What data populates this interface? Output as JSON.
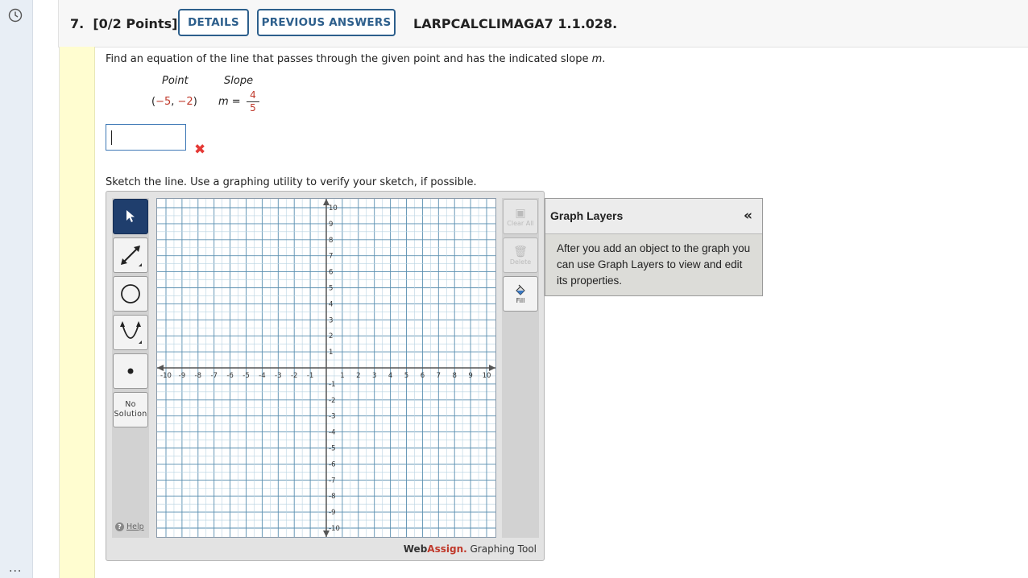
{
  "rail": {
    "clock_icon": "clock-icon",
    "more_label": "..."
  },
  "question": {
    "number": "7.",
    "points": "[0/2 Points]",
    "details_label": "DETAILS",
    "previous_label": "PREVIOUS ANSWERS",
    "code": "LARPCALCLIMAGA7 1.1.028."
  },
  "problem": {
    "prompt_before": "Find an equation of the line that passes through the given point and has the indicated slope ",
    "prompt_var": "m",
    "prompt_after": ".",
    "point_header": "Point",
    "slope_header": "Slope",
    "point_open": "(",
    "point_x": "−5",
    "point_sep": ", ",
    "point_y": "−2",
    "point_close": ")",
    "slope_var": "m",
    "slope_eq": " =",
    "slope_num": "4",
    "slope_den": "5",
    "answer_value": "",
    "answer_status": "incorrect",
    "sketch_prompt": "Sketch the line. Use a graphing utility to verify your sketch, if possible."
  },
  "graph_tool": {
    "tools": [
      "pointer-tool",
      "line-tool",
      "circle-tool",
      "parabola-tool",
      "point-tool"
    ],
    "no_solution_line1": "No",
    "no_solution_line2": "Solution",
    "help_label": "Help",
    "clear_all_label": "Clear All",
    "delete_label": "Delete",
    "fill_label": "Fill",
    "brand_web": "Web",
    "brand_assign": "Assign.",
    "brand_suffix": " Graphing Tool",
    "axis_min": -10,
    "axis_max": 10,
    "x_ticks": [
      "-10",
      "-9",
      "-8",
      "-7",
      "-6",
      "-5",
      "-4",
      "-3",
      "-2",
      "-1",
      "1",
      "2",
      "3",
      "4",
      "5",
      "6",
      "7",
      "8",
      "9",
      "10"
    ],
    "y_ticks": [
      "10",
      "9",
      "8",
      "7",
      "6",
      "5",
      "4",
      "3",
      "2",
      "1",
      "-1",
      "-2",
      "-3",
      "-4",
      "-5",
      "-6",
      "-7",
      "-8",
      "-9",
      "-10"
    ]
  },
  "layers": {
    "title": "Graph Layers",
    "collapse_label": "«",
    "body": "After you add an object to the graph you can use Graph Layers to view and edit its properties."
  }
}
